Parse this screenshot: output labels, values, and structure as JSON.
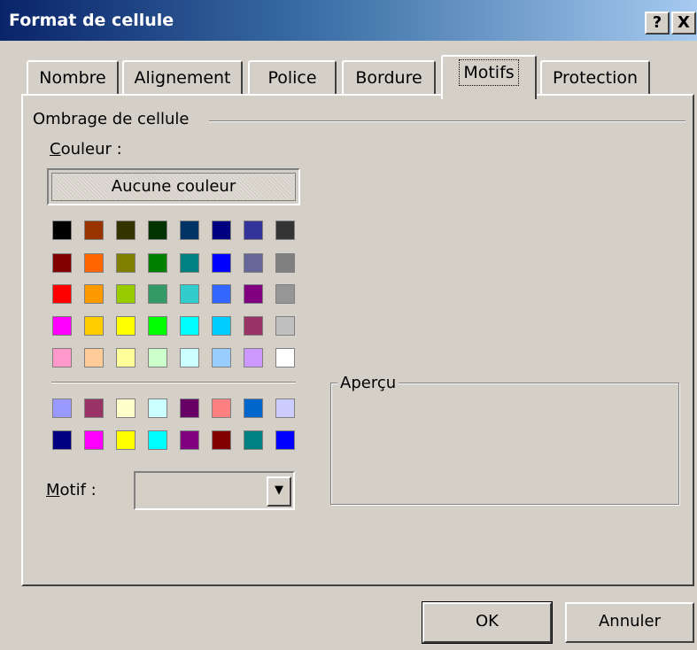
{
  "window": {
    "title": "Format de cellule",
    "help_label": "?",
    "close_label": "X"
  },
  "tabs": [
    {
      "label": "Nombre",
      "active": false
    },
    {
      "label": "Alignement",
      "active": false
    },
    {
      "label": "Police",
      "active": false
    },
    {
      "label": "Bordure",
      "active": false
    },
    {
      "label": "Motifs",
      "active": true
    },
    {
      "label": "Protection",
      "active": false
    }
  ],
  "shading": {
    "group_label": "Ombrage de cellule",
    "color_label_accel": "C",
    "color_label_rest": "ouleur :",
    "no_color_label": "Aucune couleur",
    "palette_rows": [
      [
        "#000000",
        "#993300",
        "#333300",
        "#003300",
        "#003366",
        "#000080",
        "#333399",
        "#333333"
      ],
      [
        "#800000",
        "#FF6600",
        "#808000",
        "#008000",
        "#008080",
        "#0000FF",
        "#666699",
        "#808080"
      ],
      [
        "#FF0000",
        "#FF9900",
        "#99CC00",
        "#339966",
        "#33CCCC",
        "#3366FF",
        "#800080",
        "#969696"
      ],
      [
        "#FF00FF",
        "#FFCC00",
        "#FFFF00",
        "#00FF00",
        "#00FFFF",
        "#00CCFF",
        "#993366",
        "#C0C0C0"
      ],
      [
        "#FF99CC",
        "#FFCC99",
        "#FFFF99",
        "#CCFFCC",
        "#CCFFFF",
        "#99CCFF",
        "#CC99FF",
        "#FFFFFF"
      ]
    ],
    "chart_palette_rows": [
      [
        "#9999FF",
        "#993366",
        "#FFFFCC",
        "#CCFFFF",
        "#660066",
        "#FF8080",
        "#0066CC",
        "#CCCCFF"
      ],
      [
        "#000080",
        "#FF00FF",
        "#FFFF00",
        "#00FFFF",
        "#800080",
        "#800000",
        "#008080",
        "#0000FF"
      ]
    ],
    "pattern_label_accel": "M",
    "pattern_label_rest": "otif :",
    "pattern_value": ""
  },
  "preview": {
    "label": "Aperçu"
  },
  "buttons": {
    "ok_label": "OK",
    "cancel_label": "Annuler"
  }
}
